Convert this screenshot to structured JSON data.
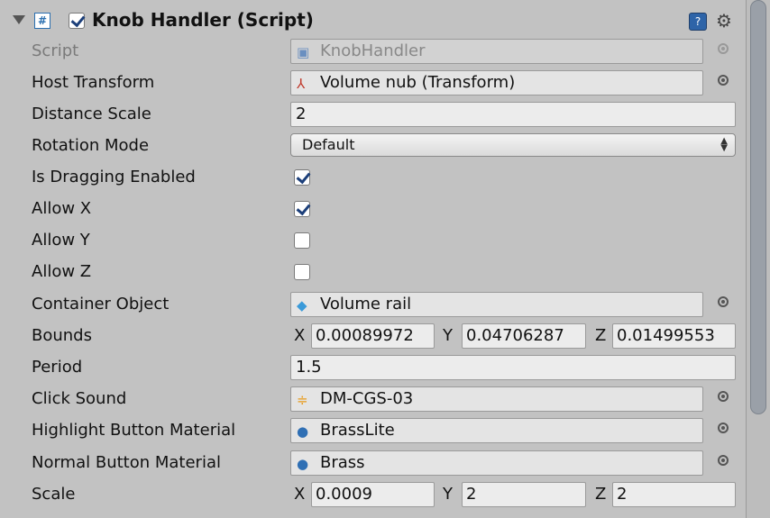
{
  "component": {
    "title": "Knob Handler (Script)",
    "enabled": true,
    "script_icon": "script-icon",
    "help_icon": "help-icon",
    "settings_icon": "gear-icon"
  },
  "fields": {
    "script": {
      "label": "Script",
      "value": "KnobHandler",
      "icon": "script-asset-icon"
    },
    "host_transform": {
      "label": "Host Transform",
      "value": "Volume nub (Transform)",
      "icon": "transform-icon"
    },
    "distance_scale": {
      "label": "Distance Scale",
      "value": "2"
    },
    "rotation_mode": {
      "label": "Rotation Mode",
      "value": "Default"
    },
    "is_dragging_enabled": {
      "label": "Is Dragging Enabled",
      "checked": true
    },
    "allow_x": {
      "label": "Allow X",
      "checked": true
    },
    "allow_y": {
      "label": "Allow Y",
      "checked": false
    },
    "allow_z": {
      "label": "Allow Z",
      "checked": false
    },
    "container_object": {
      "label": "Container Object",
      "value": "Volume rail",
      "icon": "gameobject-cube-icon"
    },
    "bounds": {
      "label": "Bounds",
      "x_label": "X",
      "x": "0.00089972",
      "y_label": "Y",
      "y": "0.04706287",
      "z_label": "Z",
      "z": "0.01499553"
    },
    "period": {
      "label": "Period",
      "value": "1.5"
    },
    "click_sound": {
      "label": "Click Sound",
      "value": "DM-CGS-03",
      "icon": "audio-clip-icon"
    },
    "highlight_button_material": {
      "label": "Highlight Button Material",
      "value": "BrassLite",
      "icon": "material-sphere-icon"
    },
    "normal_button_material": {
      "label": "Normal Button Material",
      "value": "Brass",
      "icon": "material-sphere-icon"
    },
    "scale": {
      "label": "Scale",
      "x_label": "X",
      "x": "0.0009",
      "y_label": "Y",
      "y": "2",
      "z_label": "Z",
      "z": "2"
    }
  }
}
